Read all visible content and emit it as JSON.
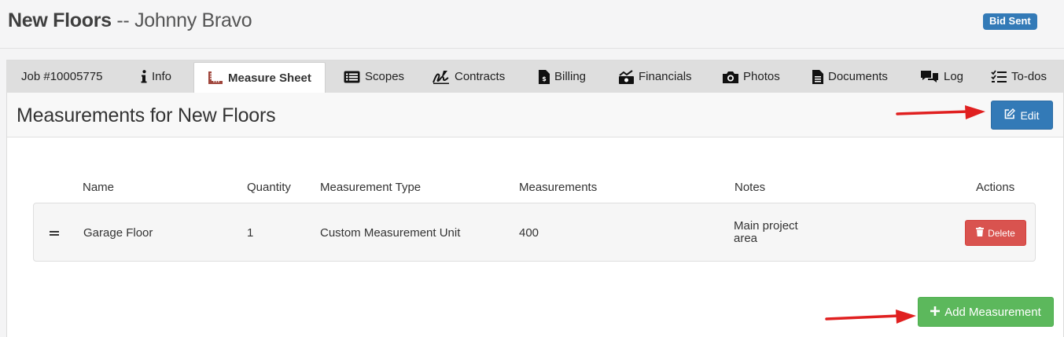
{
  "header": {
    "job_name": "New Floors",
    "separator": " -- ",
    "customer": "Johnny Bravo",
    "status_badge": "Bid Sent"
  },
  "tabs": {
    "job_number": "Job #10005775",
    "info": "Info",
    "measure_sheet": "Measure Sheet",
    "scopes": "Scopes",
    "contracts": "Contracts",
    "billing": "Billing",
    "financials": "Financials",
    "photos": "Photos",
    "documents": "Documents",
    "log": "Log",
    "todos": "To-dos"
  },
  "section": {
    "title": "Measurements for New Floors",
    "edit_label": "Edit"
  },
  "table": {
    "columns": {
      "name": "Name",
      "quantity": "Quantity",
      "type": "Measurement Type",
      "measurements": "Measurements",
      "notes": "Notes",
      "actions": "Actions"
    },
    "rows": [
      {
        "name": "Garage Floor",
        "quantity": "1",
        "type": "Custom Measurement Unit",
        "measurements": "400",
        "notes": "Main project area",
        "delete_label": "Delete"
      }
    ]
  },
  "add_measurement_label": "Add Measurement",
  "colors": {
    "primary": "#337ab7",
    "danger": "#d9534f",
    "success": "#5cb85c",
    "arrow": "#e02020",
    "measure_icon": "#a0463c"
  },
  "icons": {
    "info": "info-icon",
    "measure_sheet": "ruler-icon",
    "scopes": "list-icon",
    "contracts": "signature-icon",
    "billing": "invoice-icon",
    "financials": "chart-icon",
    "photos": "camera-icon",
    "documents": "document-icon",
    "log": "comments-icon",
    "todos": "checklist-icon",
    "edit": "edit-icon",
    "delete": "trash-icon",
    "add": "plus-icon",
    "drag": "drag-handle-icon"
  }
}
